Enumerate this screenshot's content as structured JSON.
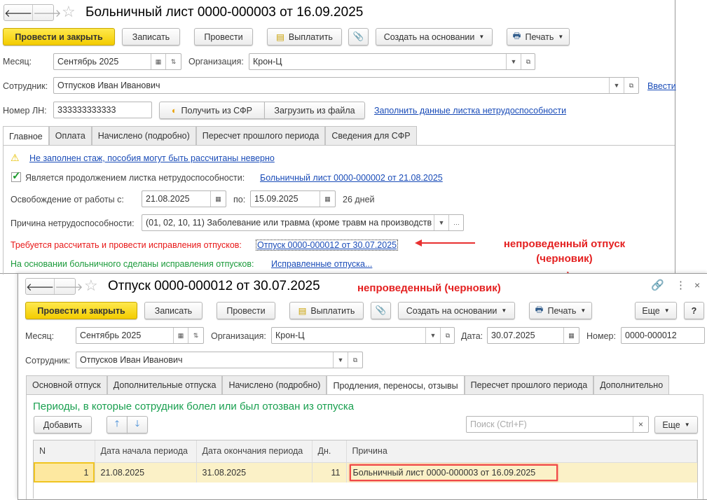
{
  "sick_leave": {
    "title": "Больничный лист 0000-000003 от 16.09.2025",
    "toolbar": {
      "post_close": "Провести и закрыть",
      "save": "Записать",
      "post": "Провести",
      "pay": "Выплатить",
      "create_based": "Создать на основании",
      "print": "Печать"
    },
    "month_label": "Месяц:",
    "month_value": "Сентябрь 2025",
    "org_label": "Организация:",
    "org_value": "Крон-Ц",
    "employee_label": "Сотрудник:",
    "employee_value": "Отпусков Иван Иванович",
    "enter_link": "Ввести",
    "ln_label": "Номер ЛН:",
    "ln_value": "333333333333",
    "get_sfr": "Получить из СФР",
    "load_file": "Загрузить из файла",
    "fill_link": "Заполнить данные листка нетрудоспособности",
    "tabs": [
      "Главное",
      "Оплата",
      "Начислено (подробно)",
      "Пересчет прошлого периода",
      "Сведения для СФР"
    ],
    "warning_link": "Не заполнен стаж, пособия могут быть рассчитаны неверно",
    "continuation_label": "Является продолжением листка нетрудоспособности:",
    "continuation_checked": true,
    "continuation_link": "Больничный лист 0000-000002 от 21.08.2025",
    "release_label": "Освобождение от работы с:",
    "release_from": "21.08.2025",
    "to_label": "по:",
    "release_to": "15.09.2025",
    "days": "26 дней",
    "reason_label": "Причина нетрудоспособности:",
    "reason_value": "(01, 02, 10, 11) Заболевание или травма (кроме травм на производств",
    "required_text": "Требуется рассчитать и провести исправления отпусков:",
    "required_link": "Отпуск 0000-000012 от 30.07.2025",
    "done_text": "На основании больничного сделаны исправления отпусков:",
    "done_link": "Исправленные отпуска..."
  },
  "annotations": {
    "note1_line1": "непроведенный отпуск",
    "note1_line2": "(черновик)",
    "note2": "непроведенный (черновик)"
  },
  "vacation": {
    "title": "Отпуск 0000-000012 от 30.07.2025",
    "toolbar": {
      "post_close": "Провести и закрыть",
      "save": "Записать",
      "post": "Провести",
      "pay": "Выплатить",
      "create_based": "Создать на основании",
      "print": "Печать",
      "more": "Еще",
      "help": "?"
    },
    "month_label": "Месяц:",
    "month_value": "Сентябрь 2025",
    "org_label": "Организация:",
    "org_value": "Крон-Ц",
    "date_label": "Дата:",
    "date_value": "30.07.2025",
    "number_label": "Номер:",
    "number_value": "0000-000012",
    "employee_label": "Сотрудник:",
    "employee_value": "Отпусков Иван Иванович",
    "tabs": [
      "Основной отпуск",
      "Дополнительные отпуска",
      "Начислено (подробно)",
      "Продления, переносы, отзывы",
      "Пересчет прошлого периода",
      "Дополнительно"
    ],
    "section_title": "Периоды, в которые сотрудник болел или был отозван из отпуска",
    "add": "Добавить",
    "search_placeholder": "Поиск (Ctrl+F)",
    "clear": "×",
    "more": "Еще",
    "columns": [
      "N",
      "Дата начала периода",
      "Дата окончания периода",
      "Дн.",
      "Причина"
    ],
    "rows": [
      [
        "1",
        "21.08.2025",
        "31.08.2025",
        "11",
        "Больничный лист 0000-000003 от 16.09.2025"
      ]
    ]
  }
}
